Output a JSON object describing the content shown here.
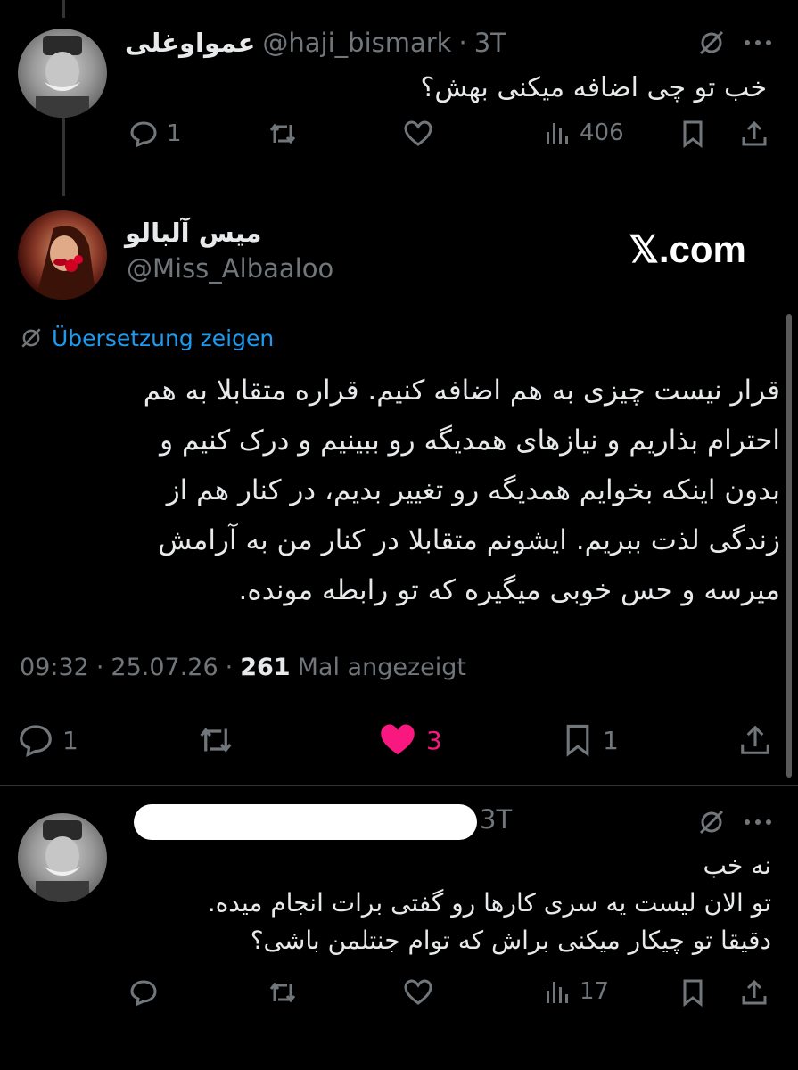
{
  "tweet1": {
    "display_name": "عمواوغلی",
    "handle": "@haji_bismark",
    "separator": "·",
    "time": "3T",
    "text": "خب تو چی اضافه میکنی بهش؟",
    "actions": {
      "replies": "1",
      "views": "406"
    }
  },
  "tweet2": {
    "display_name": "میس آلبالو",
    "handle": "@Miss_Albaaloo",
    "brand": "𝕏.com",
    "translate_label": "Übersetzung zeigen",
    "text_lines": [
      "قرار نیست چیزی به هم اضافه کنیم. قراره متقابلا به هم",
      "احترام بذاریم و نیازهای همدیگه رو ببینیم و درک کنیم و",
      "بدون اینکه بخوایم همدیگه رو تغییر بدیم، در کنار هم از",
      "زندگی لذت ببریم. ایشونم متقابلا در کنار من به آرامش",
      "میرسه و حس خوبی میگیره که تو رابطه مونده."
    ],
    "meta": {
      "time": "09:32",
      "date": "25.07.26",
      "sep": "·",
      "views": "261",
      "views_label": "Mal angezeigt"
    },
    "actions": {
      "replies": "1",
      "likes": "3",
      "bookmarks": "1"
    },
    "like_color": "#f91880"
  },
  "tweet3": {
    "time": "3T",
    "lines": [
      "نه خب",
      "تو الان لیست یه سری کارها رو گفتی برات انجام میده.",
      "دقیقا تو چیکار میکنی براش که توام جنتلمن باشی؟"
    ],
    "actions": {
      "views": "17"
    }
  },
  "colors": {
    "link": "#1d9bf0",
    "muted": "#71767b",
    "text": "#e7e9ea",
    "like": "#f91880"
  }
}
